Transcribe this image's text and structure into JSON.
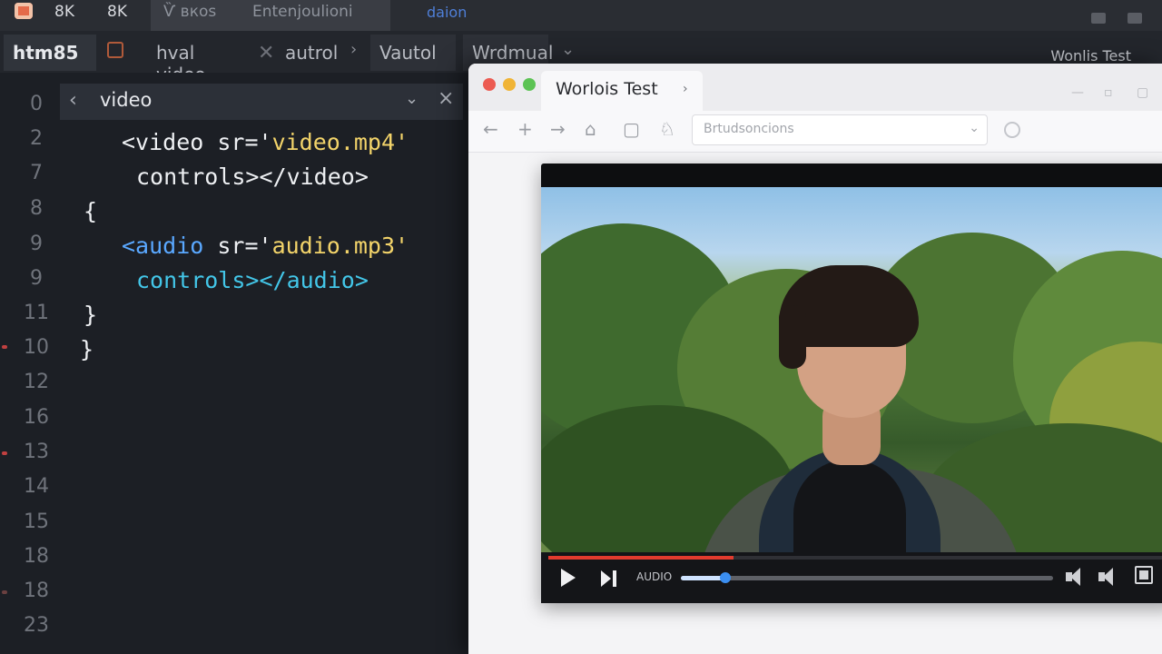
{
  "topbar": {
    "label_1": "8K",
    "label_2": "8K",
    "tab_1": "Ѷ вкоѕ",
    "tab_2": "Entenjoulioni",
    "link": "daion"
  },
  "tabbar": {
    "tabs": [
      "htm85",
      "hval video",
      "autrol",
      "Vautol",
      "Wrdmual"
    ],
    "right_label": "Wonlis Test"
  },
  "editor": {
    "find_text": "video",
    "line_numbers": [
      "0",
      "2",
      "7",
      "8",
      "9",
      "9",
      "11",
      "10",
      "12",
      "16",
      "13",
      "14",
      "15",
      "18",
      "18",
      "23"
    ],
    "code": {
      "video_open": "<video sr='",
      "video_src": "video.mp4'",
      "video_close": "controls></video>",
      "brace_1": "{",
      "audio_tag": "<audio",
      "audio_attr": " sr='",
      "audio_src": "audio.mp3'",
      "audio_close": "controls></audio>",
      "brace_2": "}",
      "brace_3": "}"
    }
  },
  "browser": {
    "tab_title": "Worlois Test",
    "url_text": "Brtudsoncions",
    "player": {
      "audio_label": "AUDIO",
      "progress": 0.3,
      "seek": 0.12
    }
  }
}
